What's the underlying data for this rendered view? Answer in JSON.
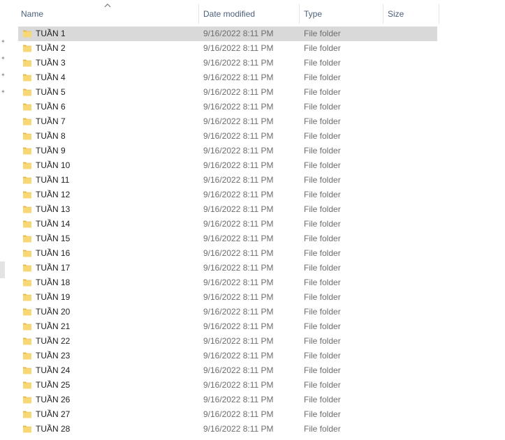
{
  "columns": {
    "name": "Name",
    "date_modified": "Date modified",
    "type": "Type",
    "size": "Size"
  },
  "sort": {
    "column": "name",
    "direction": "ascending",
    "icon": "chevron-up-icon"
  },
  "colors": {
    "folder": "#f8d775",
    "folder_dark": "#e6b746",
    "selected_row": "#d9d9d9",
    "header_text": "#4c607a",
    "secondary_text": "#6d6d6d"
  },
  "items": [
    {
      "name": "TUẦN 1",
      "date": "9/16/2022 8:11 PM",
      "type": "File folder",
      "selected": true
    },
    {
      "name": "TUẦN 2",
      "date": "9/16/2022 8:11 PM",
      "type": "File folder"
    },
    {
      "name": "TUẦN 3",
      "date": "9/16/2022 8:11 PM",
      "type": "File folder"
    },
    {
      "name": "TUẦN 4",
      "date": "9/16/2022 8:11 PM",
      "type": "File folder"
    },
    {
      "name": "TUẦN 5",
      "date": "9/16/2022 8:11 PM",
      "type": "File folder"
    },
    {
      "name": "TUẦN 6",
      "date": "9/16/2022 8:11 PM",
      "type": "File folder"
    },
    {
      "name": "TUẦN 7",
      "date": "9/16/2022 8:11 PM",
      "type": "File folder"
    },
    {
      "name": "TUẦN 8",
      "date": "9/16/2022 8:11 PM",
      "type": "File folder"
    },
    {
      "name": "TUẦN 9",
      "date": "9/16/2022 8:11 PM",
      "type": "File folder"
    },
    {
      "name": "TUẦN 10",
      "date": "9/16/2022 8:11 PM",
      "type": "File folder"
    },
    {
      "name": "TUẦN 11",
      "date": "9/16/2022 8:11 PM",
      "type": "File folder"
    },
    {
      "name": "TUẦN 12",
      "date": "9/16/2022 8:11 PM",
      "type": "File folder"
    },
    {
      "name": "TUẦN 13",
      "date": "9/16/2022 8:11 PM",
      "type": "File folder"
    },
    {
      "name": "TUẦN 14",
      "date": "9/16/2022 8:11 PM",
      "type": "File folder"
    },
    {
      "name": "TUẦN 15",
      "date": "9/16/2022 8:11 PM",
      "type": "File folder"
    },
    {
      "name": "TUẦN 16",
      "date": "9/16/2022 8:11 PM",
      "type": "File folder"
    },
    {
      "name": "TUẦN 17",
      "date": "9/16/2022 8:11 PM",
      "type": "File folder"
    },
    {
      "name": "TUẦN 18",
      "date": "9/16/2022 8:11 PM",
      "type": "File folder"
    },
    {
      "name": "TUẦN 19",
      "date": "9/16/2022 8:11 PM",
      "type": "File folder"
    },
    {
      "name": "TUẦN 20",
      "date": "9/16/2022 8:11 PM",
      "type": "File folder"
    },
    {
      "name": "TUẦN 21",
      "date": "9/16/2022 8:11 PM",
      "type": "File folder"
    },
    {
      "name": "TUẦN 22",
      "date": "9/16/2022 8:11 PM",
      "type": "File folder"
    },
    {
      "name": "TUẦN 23",
      "date": "9/16/2022 8:11 PM",
      "type": "File folder"
    },
    {
      "name": "TUẦN 24",
      "date": "9/16/2022 8:11 PM",
      "type": "File folder"
    },
    {
      "name": "TUẦN 25",
      "date": "9/16/2022 8:11 PM",
      "type": "File folder"
    },
    {
      "name": "TUẦN 26",
      "date": "9/16/2022 8:11 PM",
      "type": "File folder"
    },
    {
      "name": "TUẦN 27",
      "date": "9/16/2022 8:11 PM",
      "type": "File folder"
    },
    {
      "name": "TUẦN 28",
      "date": "9/16/2022 8:11 PM",
      "type": "File folder"
    }
  ]
}
